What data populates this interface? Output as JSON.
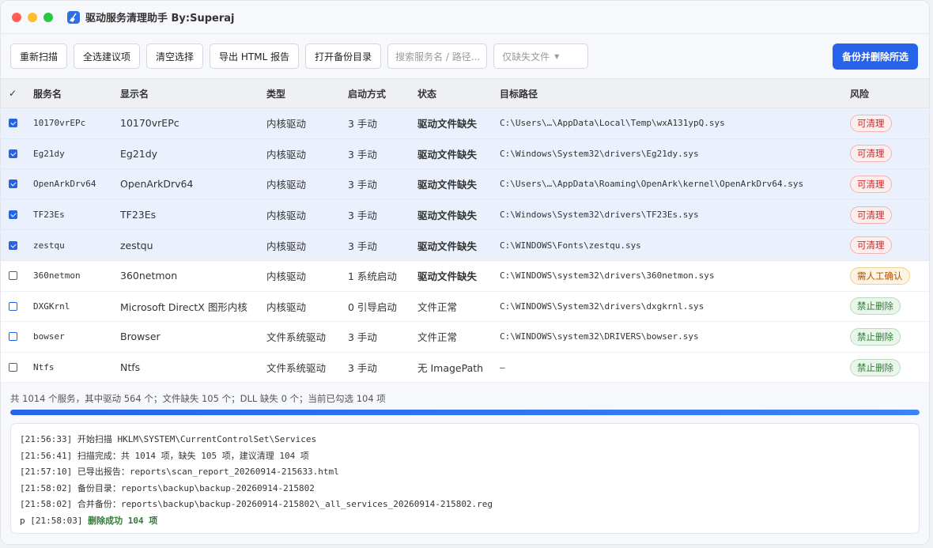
{
  "window": {
    "title": "驱动服务清理助手 By:Superaj",
    "controls": [
      "#ff5f57",
      "#febc2e",
      "#28c840"
    ]
  },
  "toolbar": {
    "rescan": "重新扫描",
    "select_suggested": "全选建议项",
    "clear_selection": "清空选择",
    "export_html": "导出 HTML 报告",
    "open_backup": "打开备份目录",
    "search_placeholder": "搜索服务名 / 路径...",
    "filter_value": "仅缺失文件",
    "backup_delete": "备份并删除所选"
  },
  "table": {
    "headers": {
      "check": "✓",
      "name": "服务名",
      "display": "显示名",
      "type": "类型",
      "start": "启动方式",
      "status": "状态",
      "path": "目标路径",
      "risk": "风险"
    },
    "rows": [
      {
        "checked": true,
        "name": "10170vrEPc",
        "display": "10170vrEPc",
        "type": "内核驱动",
        "start": "3 手动",
        "status": "驱动文件缺失",
        "path": "C:\\Users\\…\\AppData\\Local\\Temp\\wxA131ypQ.sys",
        "risk": "可清理",
        "risk_level": "red"
      },
      {
        "checked": true,
        "name": "Eg21dy",
        "display": "Eg21dy",
        "type": "内核驱动",
        "start": "3 手动",
        "status": "驱动文件缺失",
        "path": "C:\\Windows\\System32\\drivers\\Eg21dy.sys",
        "risk": "可清理",
        "risk_level": "red"
      },
      {
        "checked": true,
        "name": "OpenArkDrv64",
        "display": "OpenArkDrv64",
        "type": "内核驱动",
        "start": "3 手动",
        "status": "驱动文件缺失",
        "path": "C:\\Users\\…\\AppData\\Roaming\\OpenArk\\kernel\\OpenArkDrv64.sys",
        "risk": "可清理",
        "risk_level": "red"
      },
      {
        "checked": true,
        "name": "TF23Es",
        "display": "TF23Es",
        "type": "内核驱动",
        "start": "3 手动",
        "status": "驱动文件缺失",
        "path": "C:\\Windows\\System32\\drivers\\TF23Es.sys",
        "risk": "可清理",
        "risk_level": "red"
      },
      {
        "checked": true,
        "name": "zestqu",
        "display": "zestqu",
        "type": "内核驱动",
        "start": "3 手动",
        "status": "驱动文件缺失",
        "path": "C:\\WINDOWS\\Fonts\\zestqu.sys",
        "risk": "可清理",
        "risk_level": "red"
      },
      {
        "checked": false,
        "name": "360netmon",
        "display": "360netmon",
        "type": "内核驱动",
        "start": "1 系统启动",
        "status": "驱动文件缺失",
        "path": "C:\\WINDOWS\\system32\\drivers\\360netmon.sys",
        "risk": "需人工确认",
        "risk_level": "amber"
      },
      {
        "checked": false,
        "name": "DXGKrnl",
        "display": "Microsoft DirectX 图形内核",
        "type": "内核驱动",
        "start": "0 引导启动",
        "status": "文件正常",
        "path": "C:\\WINDOWS\\System32\\drivers\\dxgkrnl.sys",
        "risk": "禁止删除",
        "risk_level": "green"
      },
      {
        "checked": false,
        "name": "bowser",
        "display": "Browser",
        "type": "文件系统驱动",
        "start": "3 手动",
        "status": "文件正常",
        "path": "C:\\WINDOWS\\system32\\DRIVERS\\bowser.sys",
        "risk": "禁止删除",
        "risk_level": "green"
      },
      {
        "checked": false,
        "name": "Ntfs",
        "display": "Ntfs",
        "type": "文件系统驱动",
        "start": "3 手动",
        "status": "无 ImagePath",
        "path": "–",
        "risk": "禁止删除",
        "risk_level": "green"
      }
    ]
  },
  "summary": "共 1014 个服务，其中驱动 564 个；文件缺失 105 个；DLL 缺失 0 个；当前已勾选 104 项",
  "progress": 1.0,
  "log": [
    {
      "text": "[21:56:33] 开始扫描 HKLM\\SYSTEM\\CurrentControlSet\\Services"
    },
    {
      "text": "[21:56:41] 扫描完成：共 1014 项，缺失 105 项，建议清理 104 项"
    },
    {
      "text": "[21:57:10] 已导出报告：reports\\scan_report_20260914-215633.html"
    },
    {
      "text": "[21:58:02] 备份目录：reports\\backup\\backup-20260914-215802"
    },
    {
      "text": "[21:58:02] 合并备份：reports\\backup\\backup-20260914-215802\\_all_services_20260914-215802.reg"
    }
  ],
  "log_last": {
    "prefix": "p [21:58:03] ",
    "message": "删除成功 104 项"
  }
}
